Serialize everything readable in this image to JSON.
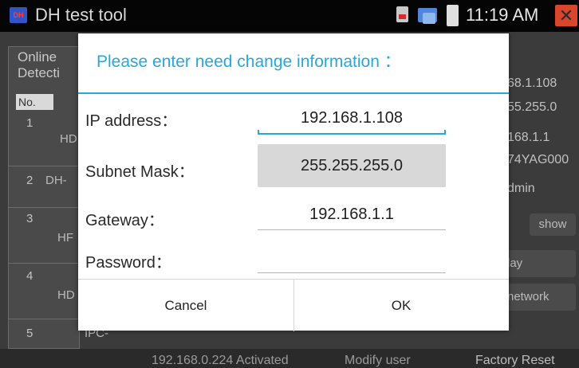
{
  "statusbar": {
    "app_logo": "DH",
    "app_title": "DH test tool",
    "time": "11:19 AM",
    "icons": [
      "sd-card-icon",
      "network-icon",
      "battery-icon",
      "close-icon"
    ],
    "close_color": "#d8462c"
  },
  "background": {
    "left_header": [
      "Online",
      "Detecti"
    ],
    "col_no": "No.",
    "rows": [
      {
        "num": "1",
        "dev": "HD"
      },
      {
        "num": "2",
        "dev": "DH-"
      },
      {
        "num": "3",
        "dev": "HF"
      },
      {
        "num": "4",
        "dev": "HD"
      },
      {
        "num": "5",
        "dev": "IPC-"
      }
    ],
    "right_values": [
      "68.1.108",
      "55.255.0",
      "168.1.1",
      "74YAG000"
    ],
    "right_field": "dmin",
    "show_button": "show",
    "play_button": "lay",
    "network_button": "network",
    "bottom_row": {
      "ip": "192.168.0.224",
      "status": "Activated",
      "modify": "Modify user",
      "factory_reset": "Factory Reset"
    }
  },
  "dialog": {
    "title": "Please enter need change information ：",
    "fields": [
      {
        "label": "IP address：",
        "value": "192.168.1.108"
      },
      {
        "label": "Subnet Mask：",
        "value": "255.255.255.0"
      },
      {
        "label": "Gateway：",
        "value": "192.168.1.1"
      },
      {
        "label": "Password：",
        "value": ""
      }
    ],
    "cancel_label": "Cancel",
    "ok_label": "OK",
    "accent_color": "#27a7dd"
  }
}
